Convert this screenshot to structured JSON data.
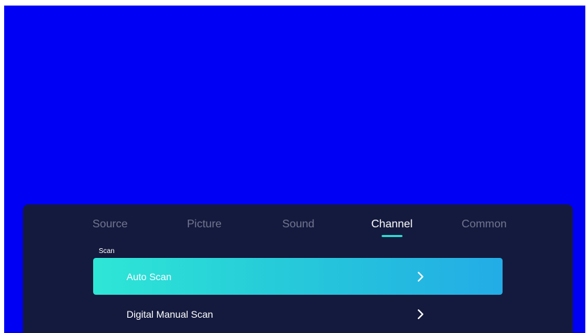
{
  "tabs": [
    {
      "label": "Source",
      "active": false
    },
    {
      "label": "Picture",
      "active": false
    },
    {
      "label": "Sound",
      "active": false
    },
    {
      "label": "Channel",
      "active": true
    },
    {
      "label": "Common",
      "active": false
    }
  ],
  "section": {
    "label": "Scan"
  },
  "items": [
    {
      "label": "Auto Scan",
      "selected": true,
      "icon": "chevron-right-icon"
    },
    {
      "label": "Digital Manual Scan",
      "selected": false,
      "icon": "chevron-right-icon"
    }
  ],
  "colors": {
    "screen_background": "#0000f4",
    "panel_background": "#141a3d",
    "accent": "#29d9d0",
    "selected_gradient_start": "#2ee6d6",
    "selected_gradient_end": "#23ace6",
    "inactive_tab_text": "#727691"
  }
}
